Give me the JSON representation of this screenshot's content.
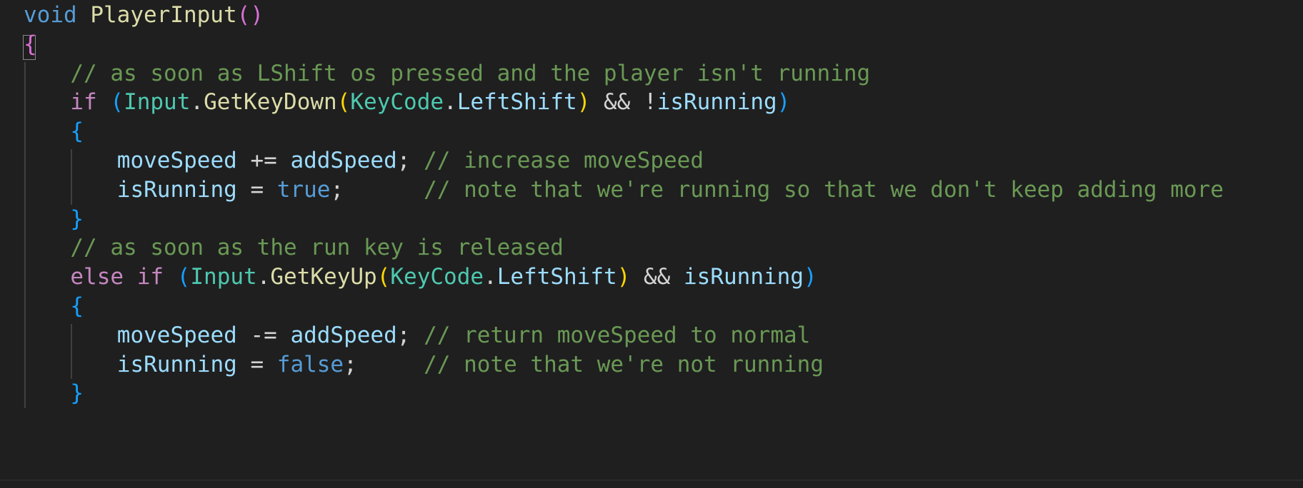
{
  "editor": {
    "theme": {
      "background": "#1f1f1f",
      "default": "#d4d4d4",
      "keyword": "#569cd6",
      "control": "#c586c0",
      "function": "#dcdcaa",
      "type": "#4ec9b0",
      "variable": "#9cdcfe",
      "comment": "#6a9955",
      "bracket1": "#da70d6",
      "bracket2": "#179fff",
      "bracket3": "#ffd700",
      "indent_guide": "#404040"
    },
    "lines": [
      {
        "indent": 0,
        "tokens": [
          {
            "text": "void",
            "kind": "keyword"
          },
          {
            "text": " ",
            "kind": "default"
          },
          {
            "text": "PlayerInput",
            "kind": "function"
          },
          {
            "text": "(",
            "kind": "bracket1"
          },
          {
            "text": ")",
            "kind": "bracket1"
          }
        ]
      },
      {
        "indent": 0,
        "tokens": [
          {
            "text": "{",
            "kind": "bracket1"
          }
        ]
      },
      {
        "indent": 4,
        "tokens": [
          {
            "text": "// as soon as LShift os pressed and the player isn't running",
            "kind": "comment"
          }
        ]
      },
      {
        "indent": 4,
        "tokens": [
          {
            "text": "if",
            "kind": "control"
          },
          {
            "text": " ",
            "kind": "default"
          },
          {
            "text": "(",
            "kind": "bracket2"
          },
          {
            "text": "Input",
            "kind": "type"
          },
          {
            "text": ".",
            "kind": "default"
          },
          {
            "text": "GetKeyDown",
            "kind": "function"
          },
          {
            "text": "(",
            "kind": "bracket3"
          },
          {
            "text": "KeyCode",
            "kind": "type"
          },
          {
            "text": ".",
            "kind": "default"
          },
          {
            "text": "LeftShift",
            "kind": "variable"
          },
          {
            "text": ")",
            "kind": "bracket3"
          },
          {
            "text": " && !",
            "kind": "default"
          },
          {
            "text": "isRunning",
            "kind": "variable"
          },
          {
            "text": ")",
            "kind": "bracket2"
          }
        ]
      },
      {
        "indent": 4,
        "tokens": [
          {
            "text": "{",
            "kind": "bracket2"
          }
        ]
      },
      {
        "indent": 8,
        "tokens": [
          {
            "text": "moveSpeed",
            "kind": "variable"
          },
          {
            "text": " += ",
            "kind": "default"
          },
          {
            "text": "addSpeed",
            "kind": "variable"
          },
          {
            "text": "; ",
            "kind": "default"
          },
          {
            "text": "// increase moveSpeed",
            "kind": "comment"
          }
        ]
      },
      {
        "indent": 8,
        "tokens": [
          {
            "text": "isRunning",
            "kind": "variable"
          },
          {
            "text": " = ",
            "kind": "default"
          },
          {
            "text": "true",
            "kind": "keyword"
          },
          {
            "text": ";      ",
            "kind": "default"
          },
          {
            "text": "// note that we're running so that we don't keep adding more",
            "kind": "comment"
          }
        ]
      },
      {
        "indent": 4,
        "tokens": [
          {
            "text": "}",
            "kind": "bracket2"
          }
        ]
      },
      {
        "indent": 4,
        "tokens": [
          {
            "text": "// as soon as the run key is released",
            "kind": "comment"
          }
        ]
      },
      {
        "indent": 4,
        "tokens": [
          {
            "text": "else",
            "kind": "control"
          },
          {
            "text": " ",
            "kind": "default"
          },
          {
            "text": "if",
            "kind": "control"
          },
          {
            "text": " ",
            "kind": "default"
          },
          {
            "text": "(",
            "kind": "bracket2"
          },
          {
            "text": "Input",
            "kind": "type"
          },
          {
            "text": ".",
            "kind": "default"
          },
          {
            "text": "GetKeyUp",
            "kind": "function"
          },
          {
            "text": "(",
            "kind": "bracket3"
          },
          {
            "text": "KeyCode",
            "kind": "type"
          },
          {
            "text": ".",
            "kind": "default"
          },
          {
            "text": "LeftShift",
            "kind": "variable"
          },
          {
            "text": ")",
            "kind": "bracket3"
          },
          {
            "text": " && ",
            "kind": "default"
          },
          {
            "text": "isRunning",
            "kind": "variable"
          },
          {
            "text": ")",
            "kind": "bracket2"
          }
        ]
      },
      {
        "indent": 4,
        "tokens": [
          {
            "text": "{",
            "kind": "bracket2"
          }
        ]
      },
      {
        "indent": 8,
        "tokens": [
          {
            "text": "moveSpeed",
            "kind": "variable"
          },
          {
            "text": " -= ",
            "kind": "default"
          },
          {
            "text": "addSpeed",
            "kind": "variable"
          },
          {
            "text": "; ",
            "kind": "default"
          },
          {
            "text": "// return moveSpeed to normal",
            "kind": "comment"
          }
        ]
      },
      {
        "indent": 8,
        "tokens": [
          {
            "text": "isRunning",
            "kind": "variable"
          },
          {
            "text": " = ",
            "kind": "default"
          },
          {
            "text": "false",
            "kind": "keyword"
          },
          {
            "text": ";     ",
            "kind": "default"
          },
          {
            "text": "// note that we're not running",
            "kind": "comment"
          }
        ]
      },
      {
        "indent": 4,
        "tokens": [
          {
            "text": "}",
            "kind": "bracket2"
          }
        ]
      }
    ]
  }
}
